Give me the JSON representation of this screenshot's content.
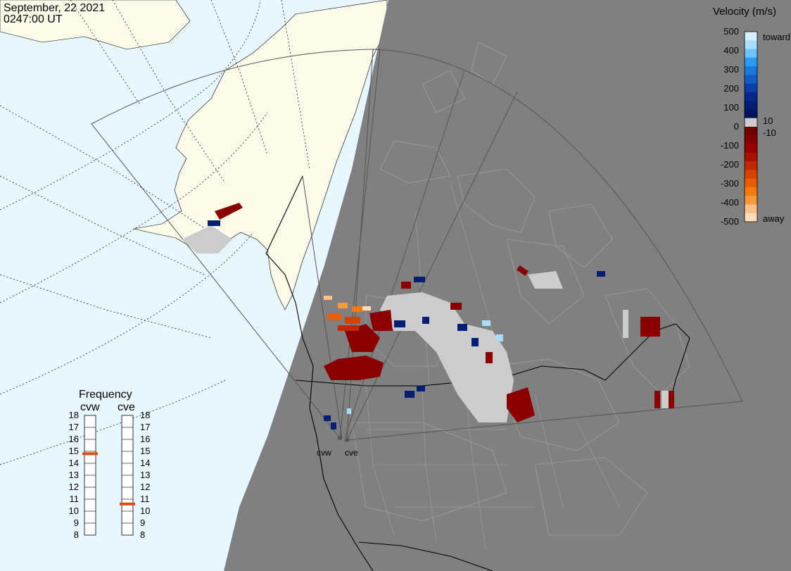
{
  "header": {
    "date": "September, 22 2021",
    "time": "0247:00 UT"
  },
  "colors": {
    "ocean": "#e8f6fe",
    "land": "#fcfbe9",
    "night": "#808080",
    "night_outline": "#999999",
    "fov_line": "#555555",
    "grid_line": "#000000",
    "ground_scatter": "#cccccc",
    "freq_marker": "#e24a1a"
  },
  "velocity_legend": {
    "title": "Velocity (m/s)",
    "ticks": [
      "500",
      "400",
      "300",
      "200",
      "100",
      "0",
      "-100",
      "-200",
      "-300",
      "-400",
      "-500"
    ],
    "toward_label": "toward",
    "away_label": "away",
    "pos_threshold": "10",
    "neg_threshold": "-10",
    "bands": [
      {
        "color": "#d6efff"
      },
      {
        "color": "#a8ddff"
      },
      {
        "color": "#6cc3ff"
      },
      {
        "color": "#2a9bf2"
      },
      {
        "color": "#1a78de"
      },
      {
        "color": "#135bc6"
      },
      {
        "color": "#0c3ea8"
      },
      {
        "color": "#062a8a"
      },
      {
        "color": "#041e74"
      },
      {
        "color": "#021460"
      },
      {
        "color": "#cccccc"
      },
      {
        "color": "#6e0000"
      },
      {
        "color": "#820000"
      },
      {
        "color": "#960000"
      },
      {
        "color": "#aa1000"
      },
      {
        "color": "#c02800"
      },
      {
        "color": "#d64200"
      },
      {
        "color": "#ea5c00"
      },
      {
        "color": "#f47a10"
      },
      {
        "color": "#f89a3a"
      },
      {
        "color": "#fcc088"
      },
      {
        "color": "#fedcb8"
      }
    ]
  },
  "frequency_panel": {
    "title": "Frequency",
    "radars": [
      {
        "name": "cvw",
        "freq_mhz": 14.8
      },
      {
        "name": "cve",
        "freq_mhz": 10.6
      }
    ],
    "ticks": [
      "18",
      "17",
      "16",
      "15",
      "14",
      "13",
      "12",
      "11",
      "10",
      "9",
      "8"
    ]
  },
  "sites": [
    {
      "name": "cvw"
    },
    {
      "name": "cve"
    }
  ]
}
